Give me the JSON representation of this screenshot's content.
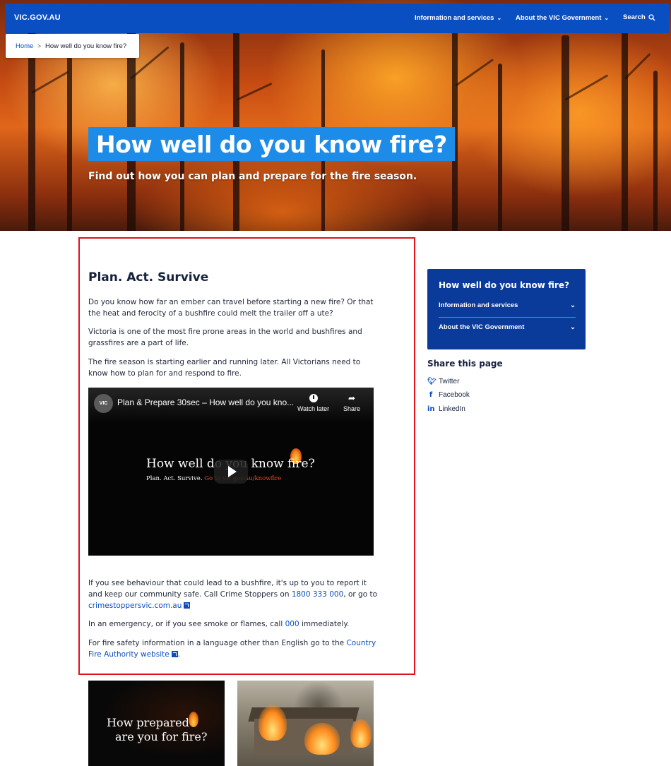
{
  "header": {
    "logo": "VIC.GOV.AU",
    "nav": [
      {
        "label": "Information and services",
        "chevron": "chevron-down-icon"
      },
      {
        "label": "About the VIC Government",
        "chevron": "chevron-down-icon"
      }
    ],
    "search_label": "Search",
    "brand_color": "#0a4fc1"
  },
  "breadcrumb": {
    "home": "Home",
    "separator": ">",
    "current": "How well do you know fire?"
  },
  "hero": {
    "title": "How well do you know fire?",
    "subtitle": "Find out how you can plan and prepare for the fire season.",
    "title_bg_color": "#1d8ce8"
  },
  "main": {
    "section_title": "Plan. Act. Survive",
    "para1": "Do you know how far an ember can travel before starting a new fire? Or that the heat and ferocity of a bushfire could melt the trailer off a ute?",
    "para2": "Victoria is one of the most fire prone areas in the world and bushfires and grassfires are a part of life.",
    "para3": "The fire season is starting earlier and running later. All Victorians need to know how to plan for and respond to fire.",
    "video": {
      "channel": "VIC",
      "title": "Plan & Prepare 30sec – How well do you kno...",
      "watch_later": "Watch later",
      "share": "Share",
      "main_text": "How well do you know fire?",
      "sub_text_a": "Plan. Act. Survive.",
      "sub_text_b": "Go to vic.gov.au/knowfire"
    },
    "para4_a": "If you see behaviour that could lead to a bushfire, it's up to you to report it and keep our community safe. Call Crime Stoppers on ",
    "para4_phone": "1800 333 000",
    "para4_b": ", or go to ",
    "para4_link": "crimestoppersvic.com.au",
    "para5_a": "In an emergency, or if you see smoke or flames, call ",
    "para5_num": "000",
    "para5_b": " immediately.",
    "para6_a": "For fire safety information in a language other than English go to the ",
    "para6_link": "Country Fire Authority website",
    "para6_b": "."
  },
  "sidebar": {
    "title": "How well do you know fire?",
    "items": [
      {
        "label": "Information and services"
      },
      {
        "label": "About the VIC Government"
      }
    ],
    "share_title": "Share this page",
    "share": [
      {
        "label": "Twitter",
        "icon": "twitter-icon"
      },
      {
        "label": "Facebook",
        "icon": "facebook-icon"
      },
      {
        "label": "LinkedIn",
        "icon": "linkedin-icon"
      }
    ]
  },
  "cards": {
    "card1_line1": "How prepared",
    "card1_line2": "are you for fire?"
  },
  "highlight_color": "#e3121b"
}
